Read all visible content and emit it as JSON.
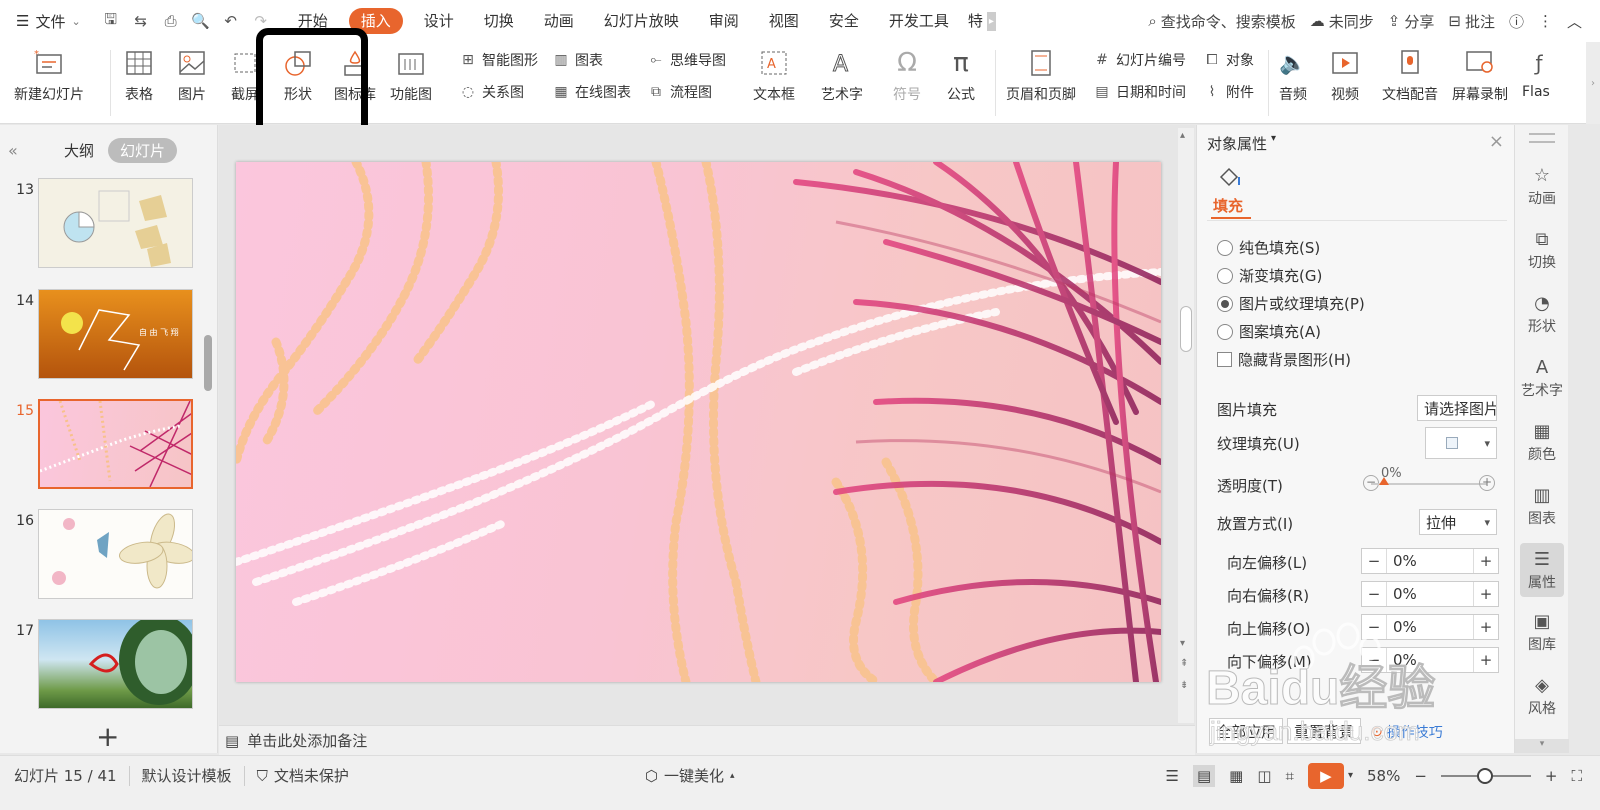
{
  "menubar": {
    "file_label": "文件",
    "tabs": [
      "开始",
      "插入",
      "设计",
      "切换",
      "动画",
      "幻灯片放映",
      "审阅",
      "视图",
      "安全",
      "开发工具",
      "特"
    ],
    "active_tab": "插入",
    "search_label": "查找命令、搜索模板",
    "sync_label": "未同步",
    "share_label": "分享",
    "review_label": "批注"
  },
  "ribbon": {
    "new_slide": "新建幻灯片",
    "table": "表格",
    "picture": "图片",
    "screenshot": "截屏",
    "shape": "形状",
    "icon_lib": "图标库",
    "function_chart": "功能图",
    "smart_art": "智能图形",
    "chart": "图表",
    "relation": "关系图",
    "online_chart": "在线图表",
    "mind_map": "思维导图",
    "flowchart": "流程图",
    "textbox": "文本框",
    "art_text": "艺术字",
    "symbol": "符号",
    "formula": "公式",
    "header_footer": "页眉和页脚",
    "slide_number": "幻灯片编号",
    "object": "对象",
    "datetime": "日期和时间",
    "attachment": "附件",
    "audio": "音频",
    "video": "视频",
    "narration": "文档配音",
    "screen_record": "屏幕录制",
    "flash": "Flas"
  },
  "left_panel": {
    "outline_tab": "大纲",
    "slides_tab": "幻灯片",
    "slides": [
      {
        "num": "13"
      },
      {
        "num": "14"
      },
      {
        "num": "15"
      },
      {
        "num": "16"
      },
      {
        "num": "17"
      }
    ],
    "active_slide": "15"
  },
  "notes_placeholder": "单击此处添加备注",
  "properties": {
    "title": "对象属性",
    "fill_tab": "填充",
    "options": [
      "纯色填充(S)",
      "渐变填充(G)",
      "图片或纹理填充(P)",
      "图案填充(A)"
    ],
    "selected_option": "图片或纹理填充(P)",
    "hide_bg": "隐藏背景图形(H)",
    "picture_fill_label": "图片填充",
    "picture_fill_value": "请选择图片",
    "texture_fill_label": "纹理填充(U)",
    "transparency_label": "透明度(T)",
    "transparency_value": "0%",
    "placement_label": "放置方式(I)",
    "placement_value": "拉伸",
    "offsets": [
      {
        "label": "向左偏移(L)",
        "value": "0%"
      },
      {
        "label": "向右偏移(R)",
        "value": "0%"
      },
      {
        "label": "向上偏移(O)",
        "value": "0%"
      },
      {
        "label": "向下偏移(M)",
        "value": "0%"
      }
    ],
    "apply_all": "全部应用",
    "reset_bg": "重置背景",
    "tips": "操作技巧"
  },
  "right_bar": [
    "动画",
    "切换",
    "形状",
    "艺术字",
    "颜色",
    "图表",
    "属性",
    "图库",
    "风格"
  ],
  "right_bar_active": "属性",
  "status": {
    "slide_info": "幻灯片 15 / 41",
    "template": "默认设计模板",
    "protection": "文档未保护",
    "beautify": "一键美化",
    "zoom": "58%"
  },
  "watermark": {
    "brand": "Baidu经验",
    "url": "jingyan.baidu.com"
  }
}
